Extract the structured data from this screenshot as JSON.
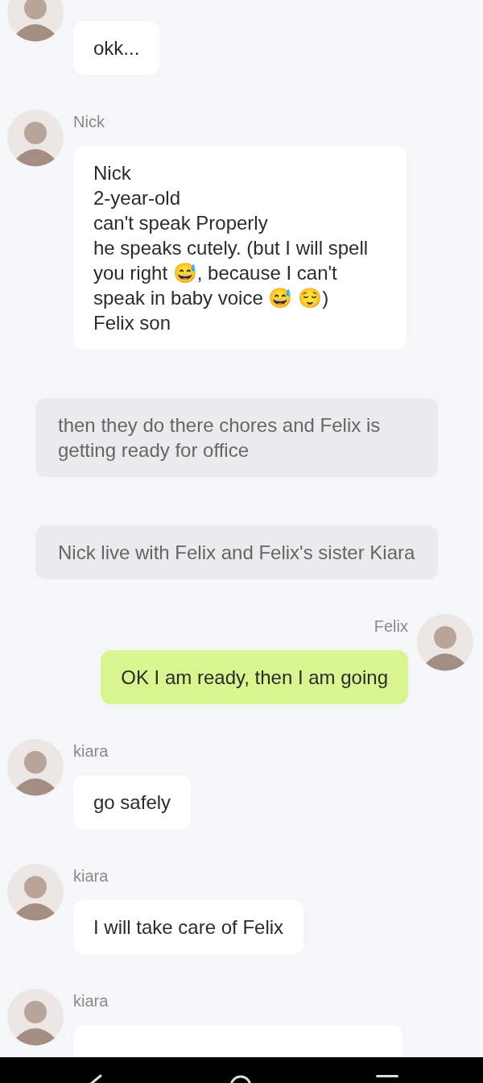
{
  "messages": [
    {
      "kind": "incoming",
      "text": "okk..."
    },
    {
      "kind": "incoming",
      "sender": "Nick",
      "text": "Nick\n2-year-old\ncan't speak Properly\nhe speaks cutely. (but I will spell you right 😅, because I can't speak in baby voice 😅 😌)\nFelix son"
    },
    {
      "kind": "narration",
      "text": "then they do there chores and Felix is getting ready for office"
    },
    {
      "kind": "narration",
      "text": "Nick live with Felix and Felix's sister Kiara"
    },
    {
      "kind": "outgoing",
      "sender": "Felix",
      "text": "OK I am ready, then I am going"
    },
    {
      "kind": "incoming",
      "sender": "kiara",
      "text": "go safely"
    },
    {
      "kind": "incoming",
      "sender": "kiara",
      "text": "I will take care of Felix"
    },
    {
      "kind": "incoming",
      "sender": "kiara"
    }
  ]
}
